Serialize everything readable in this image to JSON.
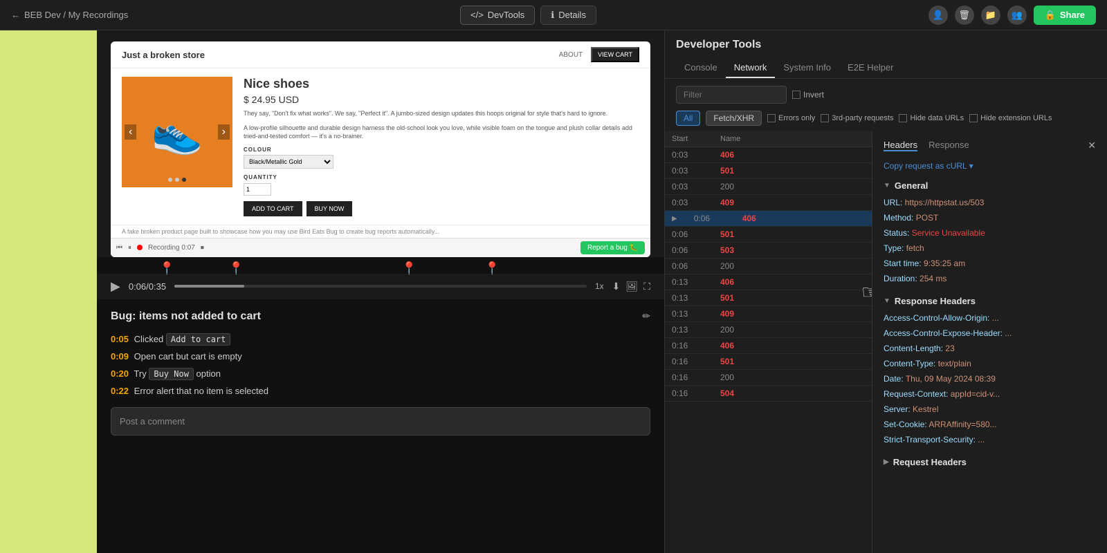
{
  "topbar": {
    "back_icon": "←",
    "breadcrumb": "BEB Dev / My Recordings",
    "devtools_label": "DevTools",
    "details_label": "Details",
    "share_label": "Share",
    "lock_icon": "🔒"
  },
  "devtools": {
    "title": "Developer Tools",
    "tabs": [
      "Console",
      "Network",
      "System Info",
      "E2E Helper"
    ],
    "active_tab": "Network",
    "filter_placeholder": "Filter",
    "invert_label": "Invert",
    "filter_buttons": [
      "All",
      "Fetch/XHR"
    ],
    "checkboxes": [
      "Errors only",
      "3rd-party requests",
      "Hide data URLs",
      "Hide extension URLs"
    ],
    "table_headers": [
      "Start",
      "Name"
    ]
  },
  "network_rows": [
    {
      "start": "0:03",
      "status": "406",
      "type": "error"
    },
    {
      "start": "0:03",
      "status": "501",
      "type": "error"
    },
    {
      "start": "0:03",
      "status": "200",
      "type": "ok"
    },
    {
      "start": "0:03",
      "status": "409",
      "type": "error"
    },
    {
      "start": "0:06",
      "status": "406",
      "type": "error",
      "has_arrow": true
    },
    {
      "start": "0:06",
      "status": "501",
      "type": "error"
    },
    {
      "start": "0:06",
      "status": "503",
      "type": "error"
    },
    {
      "start": "0:06",
      "status": "200",
      "type": "ok"
    },
    {
      "start": "0:13",
      "status": "406",
      "type": "error"
    },
    {
      "start": "0:13",
      "status": "501",
      "type": "error"
    },
    {
      "start": "0:13",
      "status": "409",
      "type": "error"
    },
    {
      "start": "0:13",
      "status": "200",
      "type": "ok"
    },
    {
      "start": "0:16",
      "status": "406",
      "type": "error"
    },
    {
      "start": "0:16",
      "status": "501",
      "type": "error"
    },
    {
      "start": "0:16",
      "status": "200",
      "type": "ok"
    },
    {
      "start": "0:16",
      "status": "504",
      "type": "error"
    }
  ],
  "headers": {
    "tabs": [
      "Headers",
      "Response"
    ],
    "active_tab": "Headers",
    "copy_request": "Copy request as",
    "copy_format": "cURL",
    "general_section": "General",
    "general_items": [
      {
        "key": "URL:",
        "value": "https://httpstat.us/503"
      },
      {
        "key": "Method:",
        "value": "POST"
      },
      {
        "key": "Status:",
        "value": "Service Unavailable",
        "highlight": "red"
      },
      {
        "key": "Type:",
        "value": "fetch"
      },
      {
        "key": "Start time:",
        "value": "9:35:25 am"
      },
      {
        "key": "Duration:",
        "value": "254 ms"
      }
    ],
    "response_section": "Response Headers",
    "response_items": [
      {
        "key": "Access-Control-Allow-Origin:",
        "value": "..."
      },
      {
        "key": "Access-Control-Expose-Header:",
        "value": "..."
      },
      {
        "key": "Content-Length:",
        "value": "23"
      },
      {
        "key": "Content-Type:",
        "value": "text/plain"
      },
      {
        "key": "Date:",
        "value": "Thu, 09 May 2024 08:39"
      },
      {
        "key": "Request-Context:",
        "value": "appId=cid-v..."
      },
      {
        "key": "Server:",
        "value": "Kestrel"
      },
      {
        "key": "Set-Cookie:",
        "value": "ARRAffinity=580..."
      },
      {
        "key": "Strict-Transport-Security:",
        "value": "..."
      }
    ],
    "request_section": "Request Headers"
  },
  "recording": {
    "title": "Bug: items not added to cart",
    "time_current": "0:06",
    "time_total": "0:35",
    "speed": "1x",
    "steps": [
      {
        "time": "0:05",
        "text": "Clicked",
        "code": "Add to cart",
        "after": ""
      },
      {
        "time": "0:09",
        "text": "Open cart but cart is empty",
        "code": null,
        "after": ""
      },
      {
        "time": "0:20",
        "text": "Try",
        "code": "Buy Now",
        "after": "option"
      },
      {
        "time": "0:22",
        "text": "Error alert that no item is selected",
        "code": null,
        "after": ""
      }
    ],
    "comment_placeholder": "Post a comment"
  },
  "fake_site": {
    "title": "Just a broken store",
    "nav_links": [
      "ABOUT"
    ],
    "cart_btn": "VIEW CART",
    "product_name": "Nice shoes",
    "price": "$ 24.95 USD",
    "desc1": "They say, \"Don't fix what works\". We say, \"Perfect it\". A jumbo-sized design updates this hoops original for style that's hard to ignore.",
    "desc2": "A low-profile silhouette and durable design harness the old-school look you love, while visible foam on the tongue and plush collar details add tried-and-tested comfort — it's a no-brainer.",
    "colour_label": "COLOUR",
    "colour_value": "Black/Metallic Gold",
    "qty_label": "QUANTITY",
    "qty_value": "1",
    "add_to_cart": "ADD TO CART",
    "buy_now": "BUY NOW",
    "caption": "A fake broken product page built to showcase how you may use Bird Eats Bug to create bug reports automatically...",
    "recording_time": "Recording 0:07",
    "report_bug": "Report a bug 🐛"
  }
}
